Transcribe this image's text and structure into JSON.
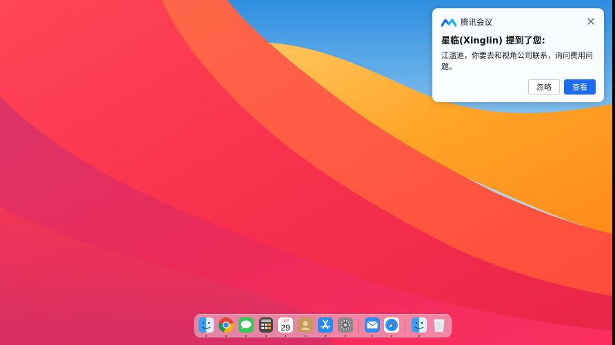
{
  "notification": {
    "app_name": "腾讯会议",
    "title": "星临(Xinglin) 提到了您:",
    "body": "江温迪，你要去和视角公司联系，询问费用问题。",
    "ignore_label": "忽略",
    "view_label": "查看",
    "app_icon": "tencent-meeting-icon",
    "close_icon": "close-icon",
    "accent_color": "#1a6cf0"
  },
  "dock": {
    "calendar": {
      "month": "JUN",
      "day": "29"
    },
    "items": [
      {
        "name": "finder",
        "icon": "finder-icon",
        "running": true
      },
      {
        "name": "chrome",
        "icon": "chrome-icon",
        "running": true
      },
      {
        "name": "messages",
        "icon": "messages-icon",
        "running": true
      },
      {
        "name": "calculator",
        "icon": "calculator-icon",
        "running": true
      },
      {
        "name": "calendar",
        "icon": "calendar-icon",
        "running": true
      },
      {
        "name": "contacts",
        "icon": "contacts-icon",
        "running": true
      },
      {
        "name": "app-store",
        "icon": "app-store-icon",
        "running": true
      },
      {
        "name": "system-preferences",
        "icon": "system-preferences-icon",
        "running": true
      },
      {
        "name": "mail",
        "icon": "mail-icon",
        "running": true
      },
      {
        "name": "safari",
        "icon": "safari-icon",
        "running": true
      },
      {
        "name": "finder-2",
        "icon": "finder-icon",
        "running": true
      },
      {
        "name": "trash",
        "icon": "trash-icon",
        "running": false
      }
    ]
  },
  "wallpaper": {
    "name": "macOS Big Sur",
    "colors": [
      "#f7344f",
      "#ff5a3c",
      "#ffb12e",
      "#3da6e8",
      "#d93a8a"
    ]
  }
}
